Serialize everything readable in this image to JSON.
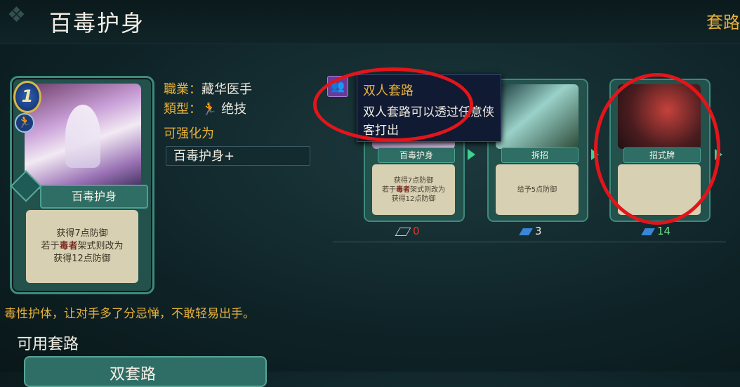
{
  "header": {
    "title": "百毒护身",
    "tab_title": "套路"
  },
  "card": {
    "cost": "1",
    "name": "百毒护身",
    "desc_line1": "获得7点防御",
    "desc_line2_pre": "若于",
    "desc_line2_keyword": "毒者",
    "desc_line2_post": "架式则改为",
    "desc_line3": "获得12点防御"
  },
  "info": {
    "class_label": "職業：",
    "class_value": "藏华医手",
    "type_label": "類型：",
    "type_value": "绝技",
    "upgrade_label": "可强化为",
    "upgrade_value": "百毒护身+"
  },
  "flavor": "毒性护体，让对手多了分忌惮，不敢轻易出手。",
  "section_title": "可用套路",
  "bottom_button": "双套路",
  "tooltip": {
    "title": "双人套路",
    "body": "双人套路可以透过任意侠客打出"
  },
  "combo_cards": [
    {
      "name": "百毒护身",
      "desc1": "获得7点防御",
      "desc2_pre": "若于",
      "desc2_kw": "毒者",
      "desc2_post": "架式则改为",
      "desc3": "获得12点防御",
      "count": "0"
    },
    {
      "name": "拆招",
      "desc1": "给予5点防御",
      "count": "3"
    },
    {
      "name": "招式牌",
      "count": "14"
    }
  ],
  "colors": {
    "accent": "#e8b13a",
    "highlight_circle": "#e2151b",
    "count_red": "#e23a2a",
    "count_white": "#f0ece0",
    "count_green": "#6fe08c"
  },
  "icons": [
    "person-icon",
    "dual-player-icon",
    "card-stack-icon"
  ]
}
